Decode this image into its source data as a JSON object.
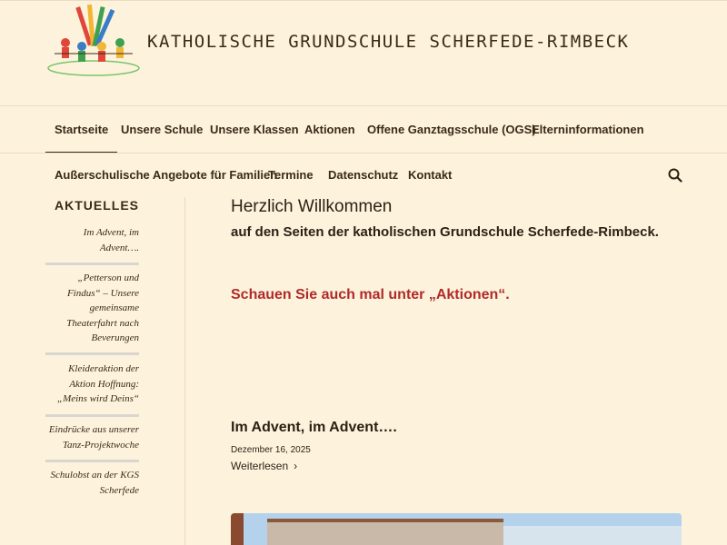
{
  "site": {
    "title": "KATHOLISCHE GRUNDSCHULE SCHERFEDE-RIMBECK"
  },
  "nav_primary": [
    {
      "label": "Startseite",
      "active": true
    },
    {
      "label": "Unsere Schule"
    },
    {
      "label": "Unsere Klassen"
    },
    {
      "label": "Aktionen"
    },
    {
      "label": "Offene Ganztagsschule (OGS)"
    },
    {
      "label": "Elterninformationen"
    }
  ],
  "nav_secondary": [
    {
      "label": "Außerschulische Angebote für Familien"
    },
    {
      "label": "Termine"
    },
    {
      "label": "Datenschutz"
    },
    {
      "label": "Kontakt"
    }
  ],
  "search": {
    "icon": "search-icon"
  },
  "sidebar": {
    "heading": "AKTUELLES",
    "items": [
      {
        "label": "Im Advent, im Advent…."
      },
      {
        "label": "„Petterson und Findus“ – Unsere gemeinsame Theaterfahrt nach Beverungen"
      },
      {
        "label": "Kleideraktion der Aktion Hoffnung: „Meins wird Deins“"
      },
      {
        "label": "Eindrücke aus unserer Tanz-Projektwoche"
      },
      {
        "label": "Schulobst an der KGS Scherfede"
      }
    ]
  },
  "main": {
    "welcome_title": "Herzlich Willkommen",
    "welcome_sub": "auf den Seiten der katholischen Grundschule Scherfede-Rimbeck.",
    "aktionen_note": "Schauen Sie auch mal unter „Aktionen“.",
    "post": {
      "title": "Im Advent, im Advent….",
      "date": "Dezember 16, 2025",
      "read_more": "Weiterlesen"
    }
  },
  "colors": {
    "background": "#fdf3dc",
    "text": "#3a2a1a",
    "accent_red": "#b02a2a",
    "divider": "#e9dcc0"
  }
}
